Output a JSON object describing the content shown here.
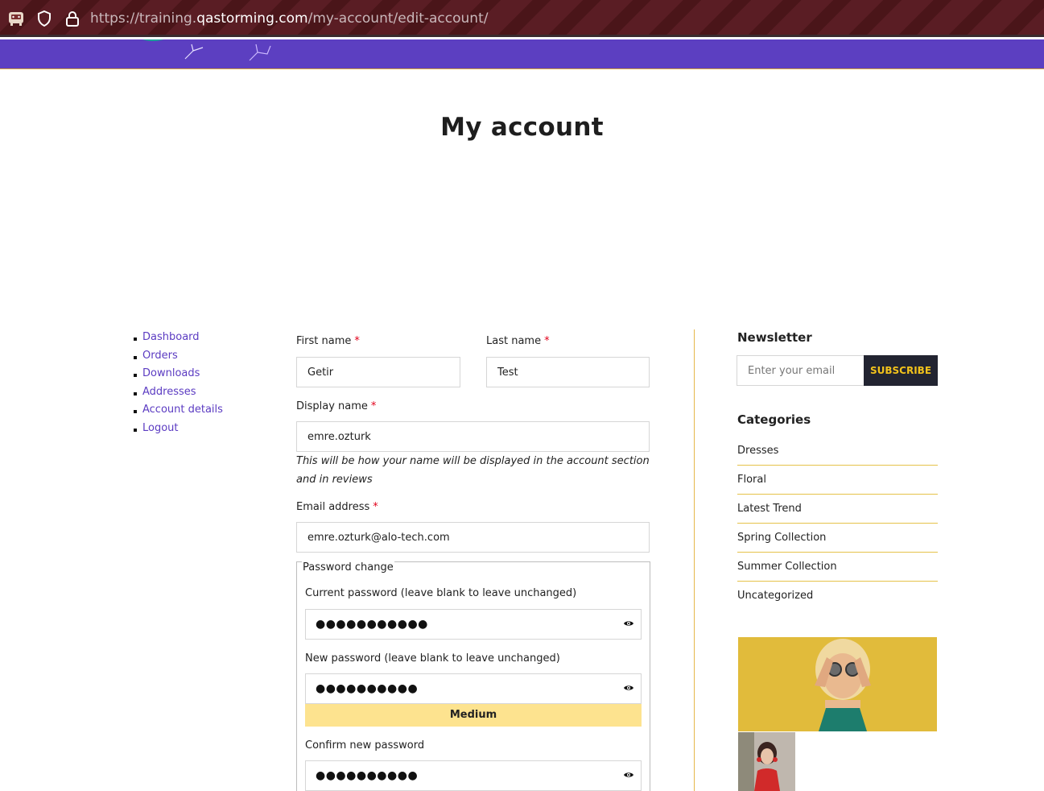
{
  "browser": {
    "url_prefix": "https://training.",
    "url_domain": "qastorming.com",
    "url_path": "/my-account/edit-account/"
  },
  "page": {
    "title": "My account"
  },
  "account_nav": {
    "items": [
      "Dashboard",
      "Orders",
      "Downloads",
      "Addresses",
      "Account details",
      "Logout"
    ]
  },
  "form": {
    "first_name": {
      "label": "First name",
      "value": "Getir"
    },
    "last_name": {
      "label": "Last name",
      "value": "Test"
    },
    "display_name": {
      "label": "Display name",
      "value": "emre.ozturk",
      "hint": "This will be how your name will be displayed in the account section and in reviews"
    },
    "email": {
      "label": "Email address",
      "value": "emre.ozturk@alo-tech.com"
    },
    "required_mark": "*",
    "password_change": {
      "legend": "Password change",
      "current": {
        "label": "Current password (leave blank to leave unchanged)",
        "masked": "●●●●●●●●●●●"
      },
      "new": {
        "label": "New password (leave blank to leave unchanged)",
        "masked": "●●●●●●●●●●"
      },
      "strength": "Medium",
      "confirm": {
        "label": "Confirm new password",
        "masked": "●●●●●●●●●●"
      }
    }
  },
  "sidebar": {
    "newsletter": {
      "title": "Newsletter",
      "placeholder": "Enter your email",
      "button": "SUBSCRIBE"
    },
    "categories": {
      "title": "Categories",
      "items": [
        "Dresses",
        "Floral",
        "Latest Trend",
        "Spring Collection",
        "Summer Collection",
        "Uncategorized"
      ]
    }
  },
  "colors": {
    "header_purple": "#5c3fc1",
    "link": "#5b3bc2",
    "accent_yellow": "#f2c21b",
    "strength_medium": "#fde38f",
    "required": "#e2001a"
  }
}
